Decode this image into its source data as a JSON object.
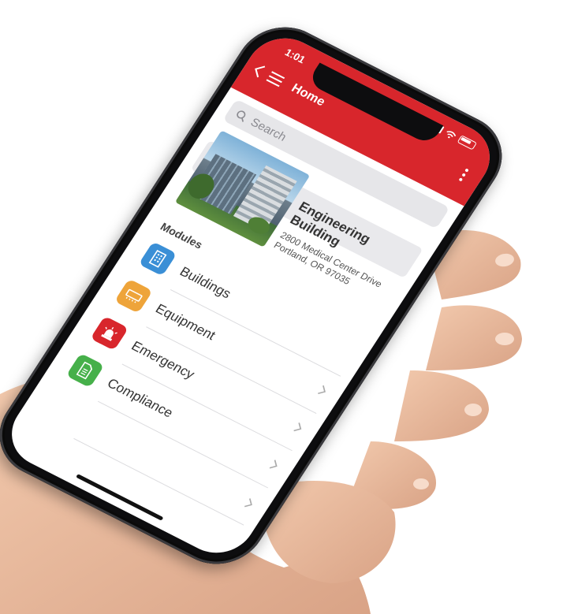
{
  "status": {
    "time": "1:01"
  },
  "header": {
    "title": "Home"
  },
  "search": {
    "placeholder": "Search"
  },
  "building": {
    "name": "Engineering Building",
    "address_line1": "2800 Medical Center Drive",
    "address_line2": "Portland, OR 97035"
  },
  "modules": {
    "title": "Modules",
    "items": [
      {
        "label": "Buildings",
        "icon": "building-icon",
        "color": "#3a8fd6"
      },
      {
        "label": "Equipment",
        "icon": "equipment-icon",
        "color": "#eea43a"
      },
      {
        "label": "Emergency",
        "icon": "siren-icon",
        "color": "#d8262c"
      },
      {
        "label": "Compliance",
        "icon": "document-icon",
        "color": "#46b04a"
      }
    ]
  },
  "colors": {
    "brand": "#d8262c",
    "background": "#ffffff"
  }
}
